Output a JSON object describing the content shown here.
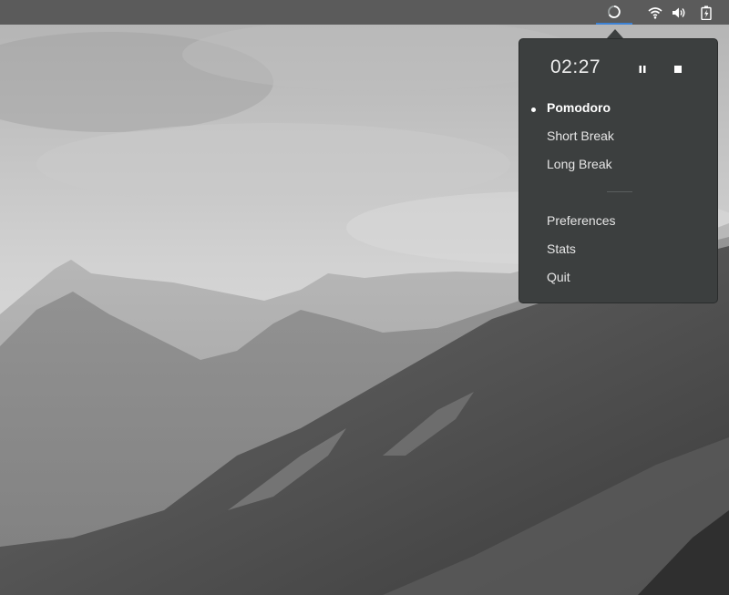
{
  "desktop": {
    "wallpaper": "mountain-landscape-grayscale"
  },
  "top_bar": {
    "tray_icons": [
      {
        "name": "pomodoro-indicator",
        "icon": "timer-ring-icon"
      },
      {
        "name": "network",
        "icon": "wifi-icon"
      },
      {
        "name": "volume",
        "icon": "speaker-icon"
      },
      {
        "name": "battery",
        "icon": "battery-charging-icon"
      }
    ],
    "accent_color": "#3d83d6"
  },
  "popup": {
    "timer": "02:27",
    "controls": {
      "pause_icon": "pause-icon",
      "stop_icon": "stop-icon"
    },
    "modes": [
      {
        "label": "Pomodoro",
        "active": true
      },
      {
        "label": "Short Break",
        "active": false
      },
      {
        "label": "Long Break",
        "active": false
      }
    ],
    "actions": [
      {
        "label": "Preferences"
      },
      {
        "label": "Stats"
      },
      {
        "label": "Quit"
      }
    ],
    "background_color": "#3c3f3f"
  }
}
